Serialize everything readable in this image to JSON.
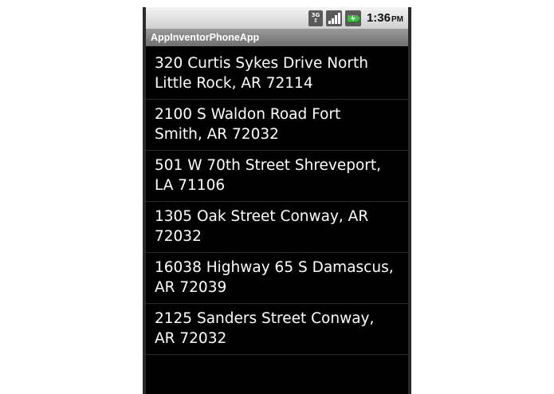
{
  "status_bar": {
    "network_label_top": "3G",
    "network_label_bottom": "↕",
    "signal_icon": "signal-bars-icon",
    "battery_icon": "battery-charging-icon",
    "time": "1:36",
    "ampm": "PM"
  },
  "app": {
    "title": "AppInventorPhoneApp"
  },
  "addresses": [
    {
      "line1": "320 Curtis Sykes Drive North",
      "line2": "Little Rock, AR 72114"
    },
    {
      "line1": "2100 S Waldon Road Fort",
      "line2": "Smith, AR 72032"
    },
    {
      "line1": "501 W 70th Street Shreveport,",
      "line2": "LA 71106"
    },
    {
      "line1": "1305 Oak Street Conway, AR",
      "line2": "72032"
    },
    {
      "line1": "16038 Highway 65 S Damascus,",
      "line2": "AR 72039"
    },
    {
      "line1": "2125 Sanders Street Conway,",
      "line2": "AR 72032"
    }
  ],
  "colors": {
    "list_background": "#000000",
    "list_text": "#ffffff",
    "title_bar": "#8a8a8a",
    "battery_accent": "#3fbf3f"
  }
}
